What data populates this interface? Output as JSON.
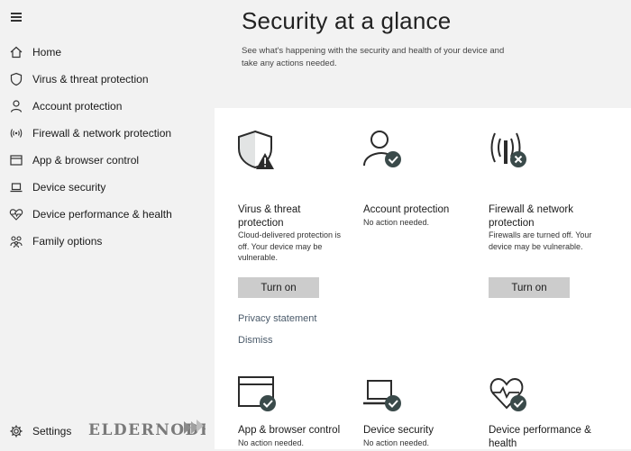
{
  "sidebar": {
    "menu_icon": "hamburger-menu-icon",
    "items": [
      {
        "label": "Home",
        "icon": "home-icon"
      },
      {
        "label": "Virus & threat protection",
        "icon": "shield-icon"
      },
      {
        "label": "Account protection",
        "icon": "person-icon"
      },
      {
        "label": "Firewall & network protection",
        "icon": "wifi-antenna-icon"
      },
      {
        "label": "App & browser control",
        "icon": "app-window-icon"
      },
      {
        "label": "Device security",
        "icon": "laptop-icon"
      },
      {
        "label": "Device performance & health",
        "icon": "heart-pulse-icon"
      },
      {
        "label": "Family options",
        "icon": "family-icon"
      }
    ],
    "settings_label": "Settings",
    "settings_icon": "gear-icon"
  },
  "header": {
    "title": "Security at a glance",
    "description": "See what's happening with the security and health of your device and take any actions needed."
  },
  "tiles": {
    "virus": {
      "title": "Virus & threat protection",
      "status": "Cloud-delivered protection is off. Your device may be vulnerable.",
      "button": "Turn on",
      "link_privacy": "Privacy statement",
      "link_dismiss": "Dismiss",
      "icon": "shield-warning-icon"
    },
    "account": {
      "title": "Account protection",
      "status": "No action needed.",
      "icon": "person-check-icon"
    },
    "firewall": {
      "title": "Firewall & network protection",
      "status": "Firewalls are turned off. Your device may be vulnerable.",
      "button": "Turn on",
      "icon": "antenna-error-icon"
    },
    "app_browser": {
      "title": "App & browser control",
      "status": "No action needed.",
      "icon": "window-check-icon"
    },
    "device_security": {
      "title": "Device security",
      "status": "No action needed.",
      "icon": "laptop-check-icon"
    },
    "device_performance": {
      "title": "Device performance & health",
      "icon": "heart-check-icon"
    }
  },
  "watermark": {
    "text": "eldernode"
  },
  "colors": {
    "sidebar_bg": "#f2f2f2",
    "panel_bg": "#ffffff",
    "button_bg": "#cccccc",
    "icon_dark": "#2b2b2b",
    "icon_accent": "#3a4a4a"
  }
}
